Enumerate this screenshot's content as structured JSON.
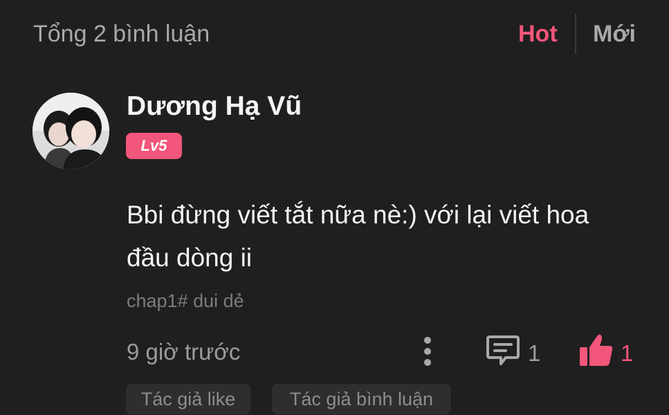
{
  "header": {
    "total_comments": "Tổng 2 bình luận",
    "sort_hot": "Hot",
    "sort_new": "Mới"
  },
  "comment": {
    "username": "Dương Hạ Vũ",
    "level": "Lv5",
    "text": "Bbi đừng viết tắt nữa nè:) với lại viết hoa đầu dòng ii",
    "chapter_tag": "chap1# dui dẻ",
    "timestamp": "9 giờ trước",
    "reply_count": "1",
    "like_count": "1",
    "badges": [
      "Tác giả like",
      "Tác giả bình luận"
    ]
  },
  "colors": {
    "accent": "#f2567a",
    "background": "#1f1f1f",
    "muted_text": "#9c9c9c"
  },
  "icons": {
    "more": "more-vertical-icon",
    "reply": "comment-bubble-icon",
    "like": "thumbs-up-icon"
  }
}
